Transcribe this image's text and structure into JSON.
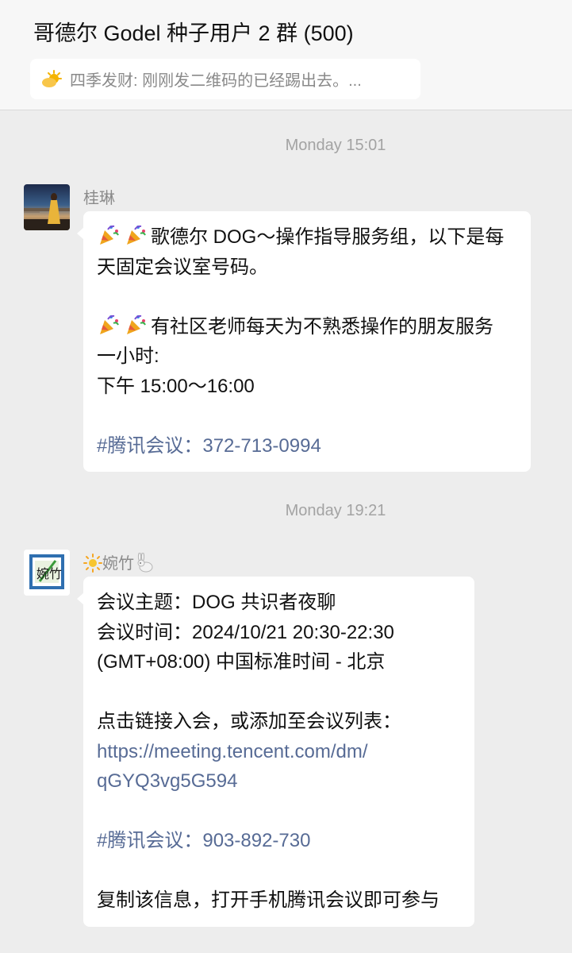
{
  "header": {
    "title": "哥德尔 Godel 种子用户 2 群 (500)",
    "pinned_message": "四季发财: 刚刚发二维码的已经踢出去。..."
  },
  "messages": [
    {
      "timestamp": "Monday 15:01",
      "sender": "桂琳",
      "lines": [
        "歌德尔 DOG～操作指导服务组，以下是每",
        "天固定会议室号码。",
        "",
        "有社区老师每天为不熟悉操作的朋友服务",
        "一小时:",
        "下午 15:00～16:00",
        "",
        "#腾讯会议：372-713-0994"
      ]
    },
    {
      "timestamp": "Monday 19:21",
      "sender": "婉竹",
      "lines": [
        "会议主题：DOG 共识者夜聊",
        "会议时间：2024/10/21 20:30-22:30",
        "(GMT+08:00) 中国标准时间 - 北京",
        "",
        "点击链接入会，或添加至会议列表：",
        "https://meeting.tencent.com/dm/",
        "qGYQ3vg5G594",
        "",
        "#腾讯会议：903-892-730",
        "",
        "复制该信息，打开手机腾讯会议即可参与"
      ]
    }
  ],
  "icons": {
    "pinned": "sun-cloud-icon",
    "celebration": "party-popper-icon",
    "sender_prefix": "sun-icon",
    "sender_suffix": "rabbit-icon"
  },
  "colors": {
    "background": "#ededed",
    "header": "#f7f7f7",
    "bubble": "#ffffff",
    "link": "#576b95",
    "meta_text": "#8a8a8a"
  }
}
